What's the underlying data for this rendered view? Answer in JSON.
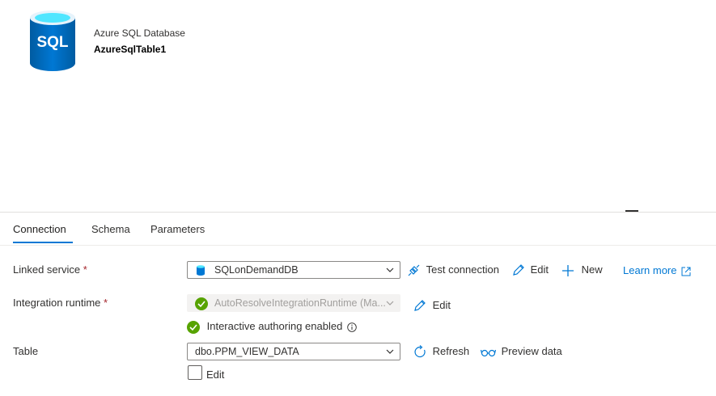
{
  "header": {
    "icon_text": "SQL",
    "dataset_type": "Azure SQL Database",
    "dataset_name": "AzureSqlTable1"
  },
  "tabs": [
    {
      "label": "Connection",
      "active": true
    },
    {
      "label": "Schema",
      "active": false
    },
    {
      "label": "Parameters",
      "active": false
    }
  ],
  "form": {
    "linked_service": {
      "label": "Linked service",
      "required_mark": "*",
      "value": "SQLonDemandDB",
      "test_connection": "Test connection",
      "edit": "Edit",
      "new": "New",
      "learn_more": "Learn more"
    },
    "integration_runtime": {
      "label": "Integration runtime",
      "required_mark": "*",
      "value": "AutoResolveIntegrationRuntime (Ma...",
      "edit": "Edit",
      "status": "Interactive authoring enabled"
    },
    "table": {
      "label": "Table",
      "value": "dbo.PPM_VIEW_DATA",
      "refresh": "Refresh",
      "preview": "Preview data",
      "edit_checkbox": "Edit"
    }
  },
  "colors": {
    "accent": "#0078d4",
    "success": "#57a300",
    "required": "#a4262c",
    "sql_icon": "#0078d4"
  }
}
